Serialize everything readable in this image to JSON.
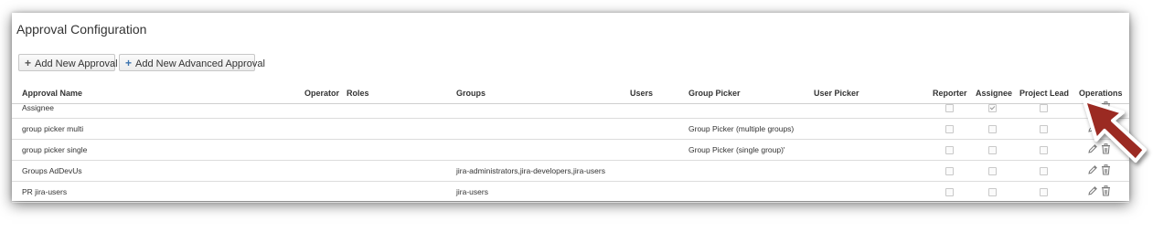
{
  "page": {
    "title": "Approval Configuration"
  },
  "toolbar": {
    "add_label": "Add New Approval",
    "add_advanced_label": "Add New Advanced Approval"
  },
  "table": {
    "headers": {
      "name": "Approval Name",
      "operator": "Operator",
      "roles": "Roles",
      "groups": "Groups",
      "users": "Users",
      "group_picker": "Group Picker",
      "user_picker": "User Picker",
      "reporter": "Reporter",
      "assignee": "Assignee",
      "project_lead": "Project Lead",
      "operations": "Operations"
    },
    "rows": [
      {
        "name": "Assignee",
        "operator": "",
        "roles": "",
        "groups": "",
        "users": "",
        "group_picker": "",
        "user_picker": "",
        "reporter": false,
        "assignee": true,
        "project_lead": false
      },
      {
        "name": "group picker multi",
        "operator": "",
        "roles": "",
        "groups": "",
        "users": "",
        "group_picker": "Group Picker (multiple groups)",
        "user_picker": "",
        "reporter": false,
        "assignee": false,
        "project_lead": false
      },
      {
        "name": "group picker single",
        "operator": "",
        "roles": "",
        "groups": "",
        "users": "",
        "group_picker": "Group Picker (single group)'",
        "user_picker": "",
        "reporter": false,
        "assignee": false,
        "project_lead": false
      },
      {
        "name": "Groups AdDevUs",
        "operator": "",
        "roles": "",
        "groups": "jira-administrators,jira-developers,jira-users",
        "users": "",
        "group_picker": "",
        "user_picker": "",
        "reporter": false,
        "assignee": false,
        "project_lead": false
      },
      {
        "name": "PR jira-users",
        "operator": "",
        "roles": "",
        "groups": "jira-users",
        "users": "",
        "group_picker": "",
        "user_picker": "",
        "reporter": false,
        "assignee": false,
        "project_lead": false
      }
    ],
    "icons": {
      "edit": "pencil-icon",
      "delete": "trash-icon"
    }
  },
  "annotation": {
    "icon": "arrow-pointer-icon",
    "color": "#9b2a24"
  }
}
